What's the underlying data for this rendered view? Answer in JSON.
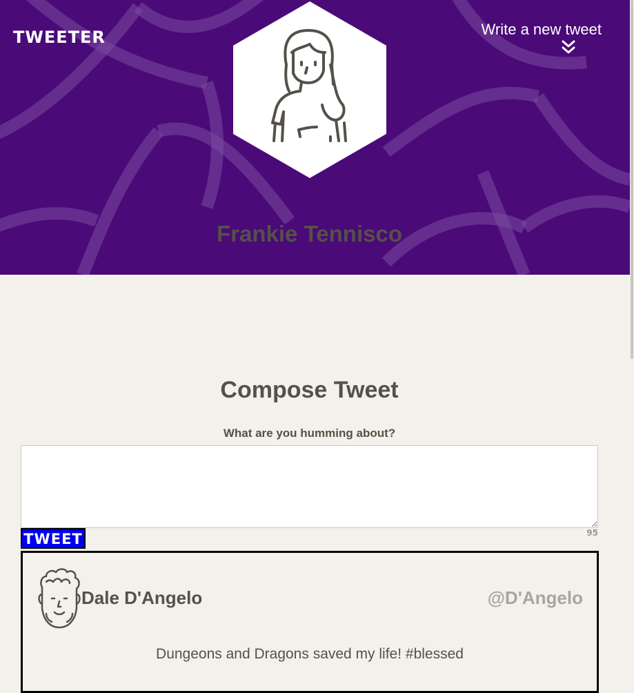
{
  "header": {
    "brand": "TWEETER",
    "write_new_label": "Write a new tweet",
    "write_new_icon": "double-chevron-down-icon",
    "profile_avatar_icon": "person-avatar-icon",
    "profile_name": "Frankie Tennisco",
    "background_color": "#4a0a78"
  },
  "compose": {
    "title": "Compose Tweet",
    "label": "What are you humming about?",
    "input_value": "",
    "button_label": "TWEET",
    "counter": "95",
    "button_color": "#0000ee"
  },
  "tweets": [
    {
      "avatar_icon": "curly-hair-avatar-icon",
      "name": "Dale D'Angelo",
      "handle": "@D'Angelo",
      "content": "Dungeons and Dragons saved my life! #blessed"
    }
  ]
}
